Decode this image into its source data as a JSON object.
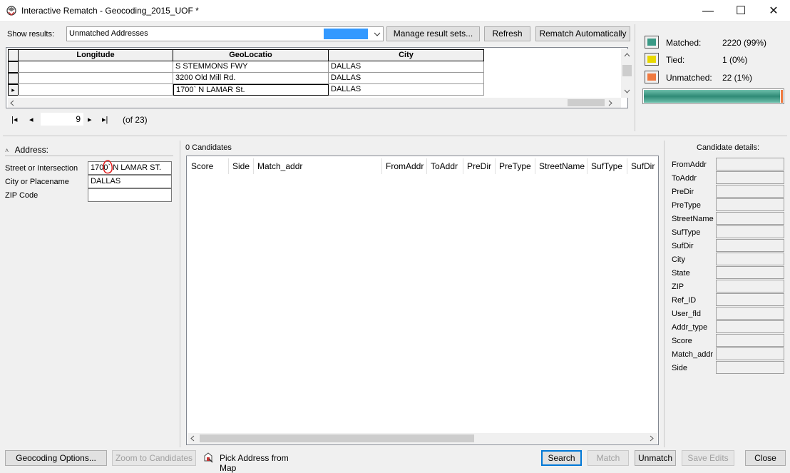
{
  "window": {
    "title": "Interactive Rematch - Geocoding_2015_UOF *",
    "minimize": "—",
    "maximize": "☐",
    "close": "✕"
  },
  "toolbar": {
    "show_results_label": "Show results:",
    "results_value": "Unmatched Addresses",
    "manage_label": "Manage result sets...",
    "refresh_label": "Refresh",
    "rematch_label": "Rematch Automatically"
  },
  "grid": {
    "columns": [
      "Longitude",
      "GeoLocatio",
      "City"
    ],
    "rows": [
      {
        "longitude": "",
        "geolocatio": "S STEMMONS FWY",
        "city": "DALLAS"
      },
      {
        "longitude": "",
        "geolocatio": "3200 Old Mill Rd.",
        "city": "DALLAS"
      },
      {
        "longitude": "",
        "geolocatio": "1700` N LAMAR St.",
        "city": "DALLAS"
      }
    ],
    "current_row_marker": "▸"
  },
  "navigator": {
    "first": "|◂",
    "prev": "◂",
    "page": "9",
    "next": "▸",
    "last": "▸|",
    "of_text": "(of 23)"
  },
  "stats": {
    "matched_label": "Matched:",
    "matched_value": "2220 (99%)",
    "tied_label": "Tied:",
    "tied_value": "1 (0%)",
    "unmatched_label": "Unmatched:",
    "unmatched_value": "22 (1%)",
    "matched_fraction": 0.99,
    "colors": {
      "matched": "#3a9a86",
      "tied": "#e8d800",
      "unmatched": "#f07a40"
    }
  },
  "address": {
    "header": "Address:",
    "street_label": "Street or Intersection",
    "street_value": "1700` N LAMAR ST.",
    "city_label": "City or Placename",
    "city_value": "DALLAS",
    "zip_label": "ZIP Code",
    "zip_value": ""
  },
  "candidates": {
    "count_label": "0 Candidates",
    "columns": [
      "Score",
      "Side",
      "Match_addr",
      "FromAddr",
      "ToAddr",
      "PreDir",
      "PreType",
      "StreetName",
      "SufType",
      "SufDir"
    ]
  },
  "details": {
    "header": "Candidate details:",
    "fields": [
      "FromAddr",
      "ToAddr",
      "PreDir",
      "PreType",
      "StreetName",
      "SufType",
      "SufDir",
      "City",
      "State",
      "ZIP",
      "Ref_ID",
      "User_fld",
      "Addr_type",
      "Score",
      "Match_addr",
      "Side"
    ]
  },
  "footer": {
    "geocoding_options": "Geocoding Options...",
    "zoom_candidates": "Zoom to Candidates",
    "pick_address": "Pick Address from Map",
    "search": "Search",
    "match": "Match",
    "unmatch": "Unmatch",
    "save_edits": "Save Edits",
    "close": "Close"
  }
}
